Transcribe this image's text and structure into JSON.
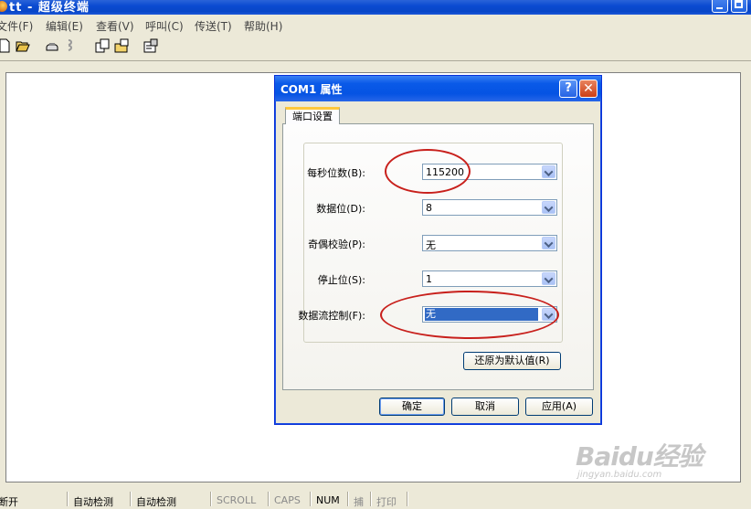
{
  "window": {
    "title": "tt - 超级终端"
  },
  "menu": [
    "文件(F)",
    "编辑(E)",
    "查看(V)",
    "呼叫(C)",
    "传送(T)",
    "帮助(H)"
  ],
  "toolbar_icons": [
    "new-connection-icon",
    "open-icon",
    "call-icon",
    "disconnect-icon",
    "send-icon",
    "receive-icon",
    "properties-icon"
  ],
  "dialog": {
    "title": "COM1 属性",
    "help_label": "?",
    "close_label": "✕",
    "tab": "端口设置",
    "fields": [
      {
        "label": "每秒位数(B):",
        "value": "115200"
      },
      {
        "label": "数据位(D):",
        "value": "8"
      },
      {
        "label": "奇偶校验(P):",
        "value": "无"
      },
      {
        "label": "停止位(S):",
        "value": "1"
      },
      {
        "label": "数据流控制(F):",
        "value": "无"
      }
    ],
    "restore_label": "还原为默认值(R)",
    "ok_label": "确定",
    "cancel_label": "取消",
    "apply_label": "应用(A)"
  },
  "status": [
    "断开",
    "自动检测",
    "自动检测",
    "SCROLL",
    "CAPS",
    "NUM",
    "捕",
    "打印"
  ],
  "watermark": {
    "logo": "Baidu经验",
    "url": "jingyan.baidu.com"
  },
  "colors": {
    "titlebar": "#0b4bd1",
    "selection": "#316ac5",
    "annotation": "#c8201c"
  }
}
